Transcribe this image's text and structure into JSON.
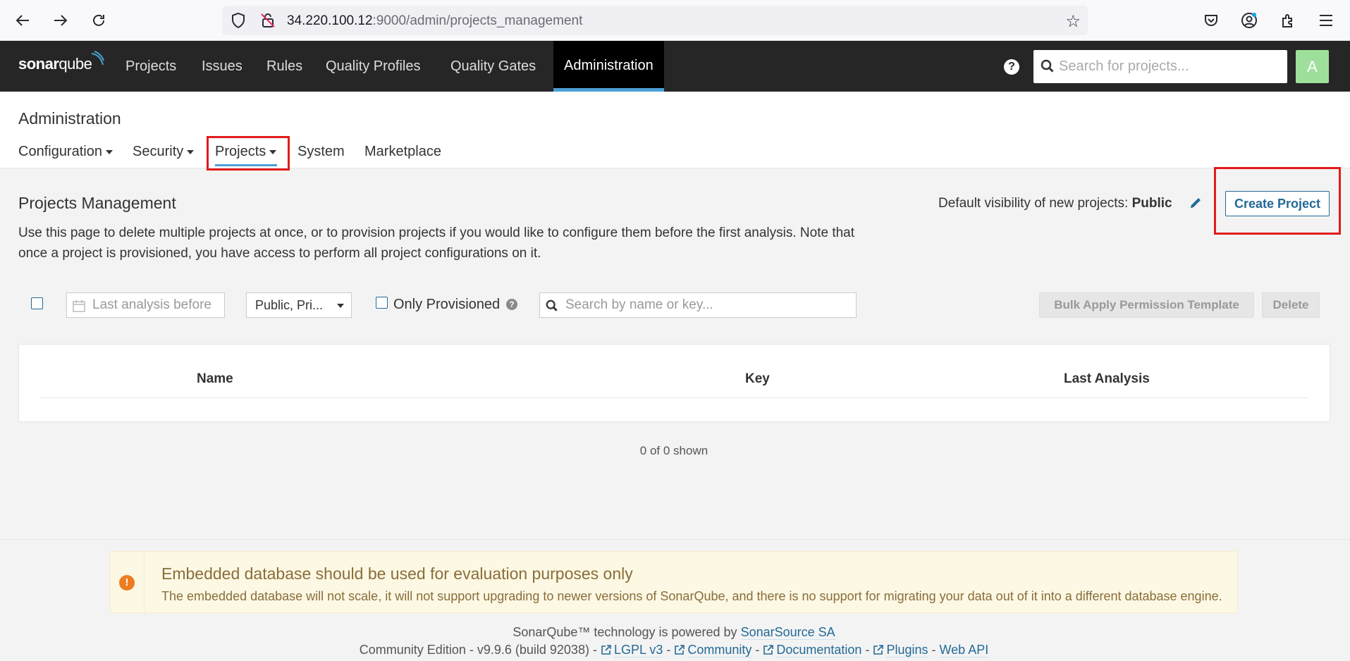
{
  "browser": {
    "url_host": "34.220.100.12",
    "url_path": ":9000/admin/projects_management"
  },
  "nav": {
    "logo_bold": "sonar",
    "logo_light": "qube",
    "items": [
      "Projects",
      "Issues",
      "Rules",
      "Quality Profiles",
      "Quality Gates",
      "Administration"
    ],
    "active": "Administration",
    "search_placeholder": "Search for projects...",
    "avatar_letter": "A"
  },
  "admin": {
    "title": "Administration",
    "tabs": [
      "Configuration",
      "Security",
      "Projects",
      "System",
      "Marketplace"
    ]
  },
  "projects_management": {
    "title": "Projects Management",
    "description": "Use this page to delete multiple projects at once, or to provision projects if you would like to configure them before the first analysis. Note that once a project is provisioned, you have access to perform all project configurations on it.",
    "visibility_label": "Default visibility of new projects:",
    "visibility_value": "Public",
    "create_button": "Create Project"
  },
  "filters": {
    "date_placeholder": "Last analysis before",
    "visibility_select": "Public, Pri...",
    "only_provisioned": "Only Provisioned",
    "search_placeholder": "Search by name or key...",
    "bulk_apply": "Bulk Apply Permission Template",
    "delete": "Delete"
  },
  "table": {
    "columns": [
      "Name",
      "Key",
      "Last Analysis"
    ],
    "rows": [],
    "count_text": "0 of 0 shown"
  },
  "warning": {
    "title": "Embedded database should be used for evaluation purposes only",
    "text": "The embedded database will not scale, it will not support upgrading to newer versions of SonarQube, and there is no support for migrating your data out of it into a different database engine."
  },
  "footer": {
    "powered_text": "SonarQube™ technology is powered by",
    "powered_link": "SonarSource SA",
    "edition": "Community Edition - v9.9.6 (build 92038) -",
    "links": [
      "LGPL v3",
      "Community",
      "Documentation",
      "Plugins",
      "Web API"
    ]
  },
  "colors": {
    "nav_bg": "#262626",
    "accent": "#4b9fd5",
    "link": "#236a97",
    "highlight_box": "#e21b1b",
    "warning_bg": "#fcf8e3"
  }
}
